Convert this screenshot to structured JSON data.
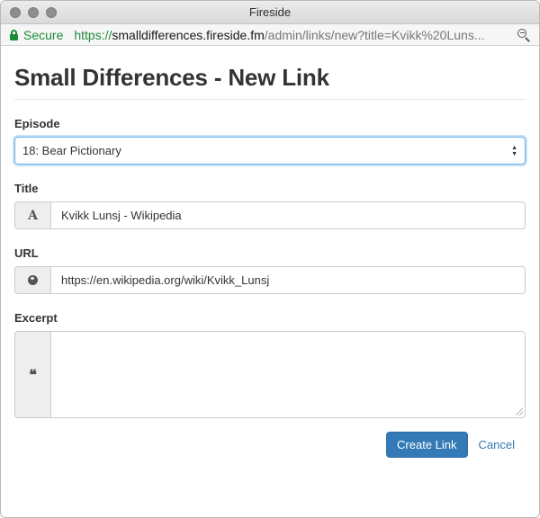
{
  "window": {
    "title": "Fireside"
  },
  "urlbar": {
    "secure_label": "Secure",
    "url_scheme": "https://",
    "url_host": "smalldifferences.fireside.fm",
    "url_path": "/admin/links/new?title=Kvikk%20Luns..."
  },
  "page": {
    "title": "Small Differences - New Link"
  },
  "form": {
    "episode": {
      "label": "Episode",
      "selected": "18: Bear Pictionary"
    },
    "title": {
      "label": "Title",
      "value": "Kvikk Lunsj - Wikipedia",
      "addon": "A"
    },
    "url": {
      "label": "URL",
      "value": "https://en.wikipedia.org/wiki/Kvikk_Lunsj"
    },
    "excerpt": {
      "label": "Excerpt",
      "value": "",
      "addon": "❝"
    }
  },
  "actions": {
    "create_label": "Create Link",
    "cancel_label": "Cancel"
  },
  "colors": {
    "primary": "#337ab7",
    "secure_green": "#1d8c3a",
    "focus_blue": "#66afe9"
  }
}
